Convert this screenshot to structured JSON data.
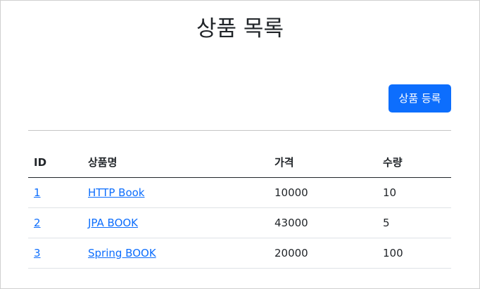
{
  "page": {
    "title": "상품 목록",
    "register_button_label": "상품 등록"
  },
  "table": {
    "headers": [
      "ID",
      "상품명",
      "가격",
      "수량"
    ],
    "rows": [
      {
        "id": "1",
        "name": "HTTP Book",
        "price": "10000",
        "quantity": "10"
      },
      {
        "id": "2",
        "name": "JPA BOOK",
        "price": "43000",
        "quantity": "5"
      },
      {
        "id": "3",
        "name": "Spring BOOK",
        "price": "20000",
        "quantity": "100"
      }
    ]
  },
  "colors": {
    "primary": "#0d6efd",
    "text": "#212529",
    "divider": "#dee2e6"
  }
}
